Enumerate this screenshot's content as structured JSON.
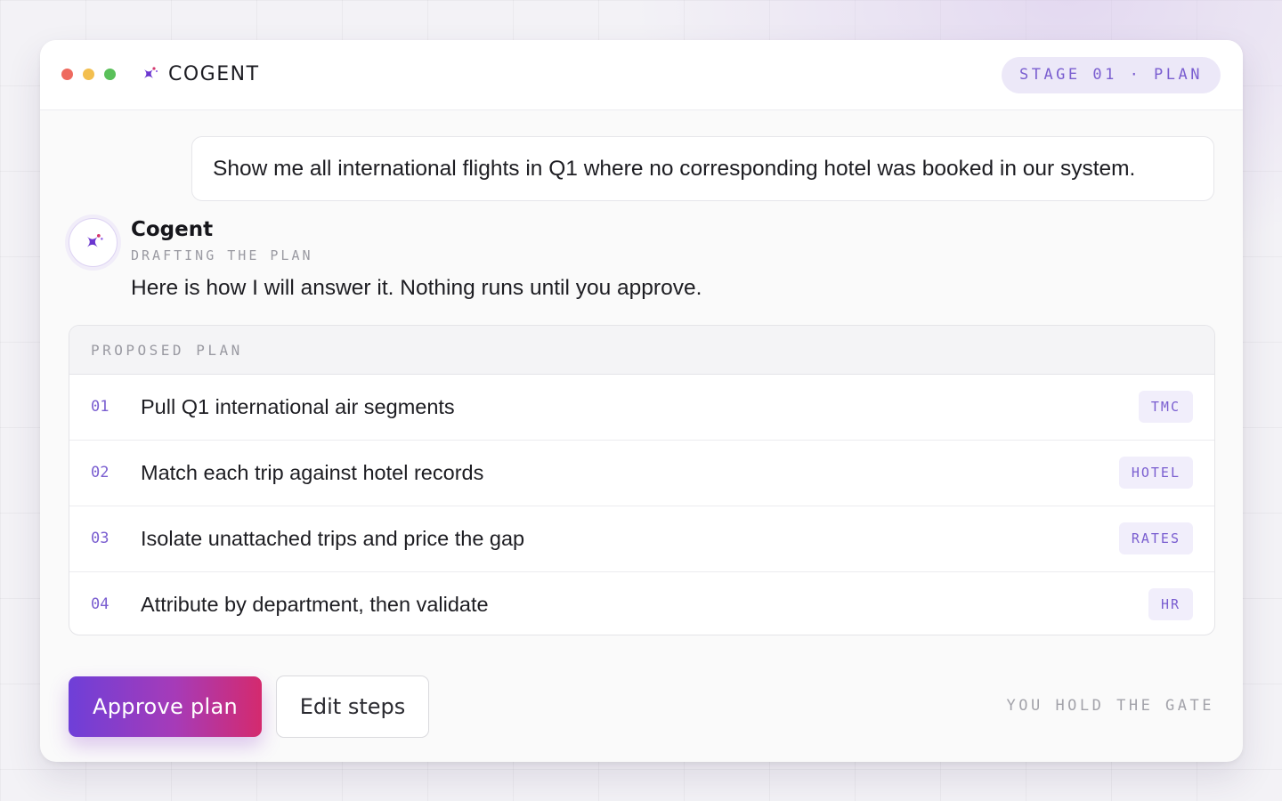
{
  "window": {
    "brand": {
      "name": "COGENT",
      "icon": "sparkle-star-icon"
    },
    "stage_badge": "STAGE 01 · PLAN"
  },
  "conversation": {
    "user_message": "Show me all international flights in Q1 where no corresponding hotel was booked in our system.",
    "agent": {
      "name": "Cogent",
      "status": "DRAFTING THE PLAN",
      "message": "Here is how I will answer it. Nothing runs until you approve."
    }
  },
  "plan": {
    "header": "PROPOSED PLAN",
    "steps": [
      {
        "num": "01",
        "text": "Pull Q1 international air segments",
        "tag": "TMC"
      },
      {
        "num": "02",
        "text": "Match each trip against hotel records",
        "tag": "HOTEL"
      },
      {
        "num": "03",
        "text": "Isolate unattached trips and price the gap",
        "tag": "RATES"
      },
      {
        "num": "04",
        "text": "Attribute by department, then validate",
        "tag": "HR"
      }
    ]
  },
  "actions": {
    "approve_label": "Approve plan",
    "edit_label": "Edit steps",
    "gate_note": "YOU HOLD THE GATE"
  },
  "colors": {
    "accent": "#7a5ed0",
    "gradient_start": "#6e3fd8",
    "gradient_end": "#d42a6e",
    "close_dot": "#ee6a5f",
    "minimize_dot": "#f3bf4f",
    "maximize_dot": "#5ac05a"
  }
}
